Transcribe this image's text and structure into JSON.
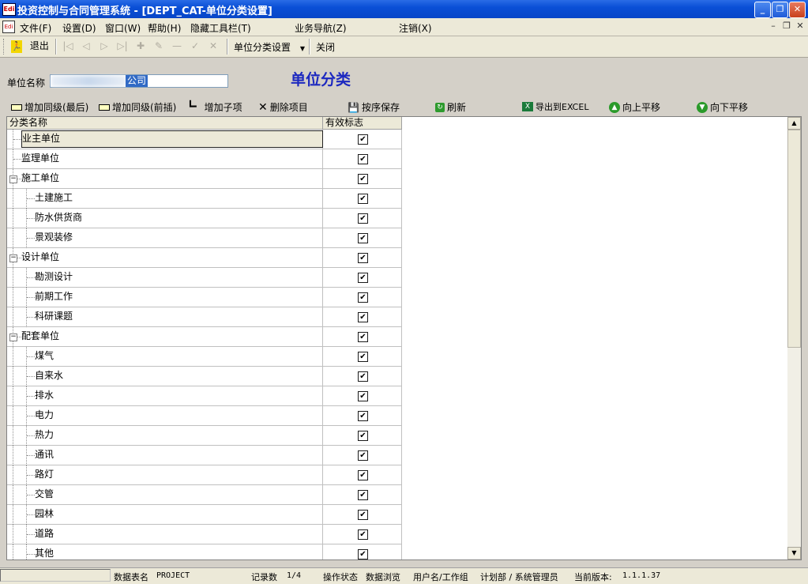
{
  "window": {
    "title": "投资控制与合同管理系统 - [DEPT_CAT-单位分类设置]",
    "app_icon_text": "Edi"
  },
  "menu": {
    "items": [
      "文件(F)",
      "设置(D)",
      "窗口(W)",
      "帮助(H)",
      "隐藏工具栏(T)",
      "业务导航(Z)",
      "注销(X)"
    ]
  },
  "toolbar": {
    "exit_label": "退出",
    "dropdown_label": "单位分类设置",
    "close_label": "关闭"
  },
  "form": {
    "unit_name_label": "单位名称",
    "unit_name_visible_value": "公司",
    "heading": "单位分类"
  },
  "actions": {
    "add_sibling_last": "增加同级(最后)",
    "add_sibling_insert": "增加同级(前插)",
    "add_child": "增加子项",
    "delete_item": "删除项目",
    "save_order": "按序保存",
    "refresh": "刷新",
    "export_excel": "导出到EXCEL",
    "move_up": "向上平移",
    "move_down": "向下平移"
  },
  "grid": {
    "columns": [
      "分类名称",
      "有效标志"
    ],
    "rows": [
      {
        "name": "业主单位",
        "level": 0,
        "checked": true,
        "selected": true
      },
      {
        "name": "监理单位",
        "level": 0,
        "checked": true
      },
      {
        "name": "施工单位",
        "level": 0,
        "checked": true,
        "expanded": true
      },
      {
        "name": "土建施工",
        "level": 1,
        "checked": true
      },
      {
        "name": "防水供货商",
        "level": 1,
        "checked": true
      },
      {
        "name": "景观装修",
        "level": 1,
        "checked": true
      },
      {
        "name": "设计单位",
        "level": 0,
        "checked": true,
        "expanded": true
      },
      {
        "name": "勘测设计",
        "level": 1,
        "checked": true
      },
      {
        "name": "前期工作",
        "level": 1,
        "checked": true
      },
      {
        "name": "科研课题",
        "level": 1,
        "checked": true
      },
      {
        "name": "配套单位",
        "level": 0,
        "checked": true,
        "expanded": true
      },
      {
        "name": "煤气",
        "level": 1,
        "checked": true
      },
      {
        "name": "自来水",
        "level": 1,
        "checked": true
      },
      {
        "name": "排水",
        "level": 1,
        "checked": true
      },
      {
        "name": "电力",
        "level": 1,
        "checked": true
      },
      {
        "name": "热力",
        "level": 1,
        "checked": true
      },
      {
        "name": "通讯",
        "level": 1,
        "checked": true
      },
      {
        "name": "路灯",
        "level": 1,
        "checked": true
      },
      {
        "name": "交管",
        "level": 1,
        "checked": true
      },
      {
        "name": "园林",
        "level": 1,
        "checked": true
      },
      {
        "name": "道路",
        "level": 1,
        "checked": true
      },
      {
        "name": "其他",
        "level": 1,
        "checked": true
      }
    ]
  },
  "status": {
    "table_label": "数据表名",
    "table_value": "PROJECT",
    "records_label": "记录数",
    "records_value": "1/4",
    "op_label": "操作状态",
    "op_value": "数据浏览",
    "user_label": "用户名/工作组",
    "user_value": "计划部 / 系统管理员",
    "version_label": "当前版本:",
    "version_value": "1.1.1.37"
  }
}
